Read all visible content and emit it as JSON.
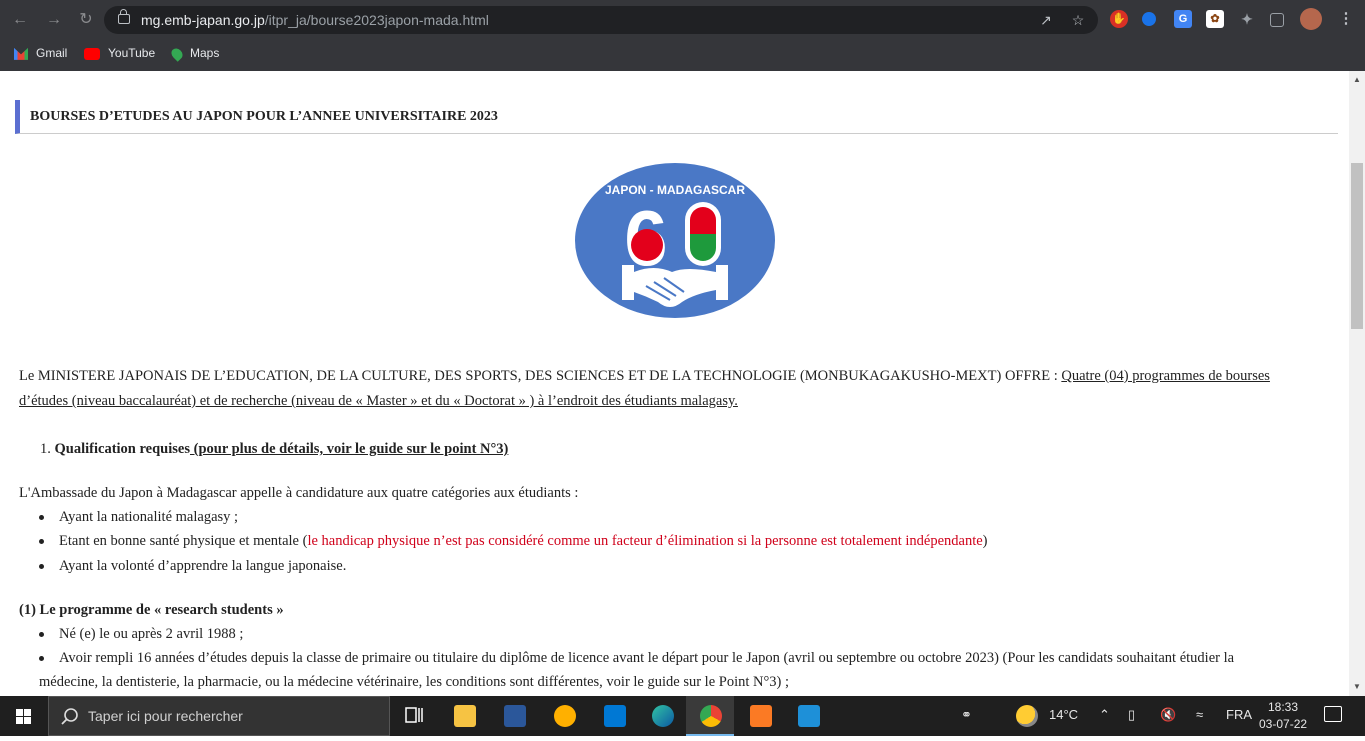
{
  "browser": {
    "url_host": "mg.emb-japan.go.jp",
    "url_path": "/itpr_ja/bourse2023japon-mada.html",
    "bookmarks": [
      "Gmail",
      "YouTube",
      "Maps"
    ]
  },
  "page": {
    "heading": "BOURSES D’ETUDES AU JAPON POUR L’ANNEE UNIVERSITAIRE 2023",
    "logo": {
      "text": "JAPON - MADAGASCAR",
      "number": "60"
    },
    "intro_a": "Le MINISTERE JAPONAIS DE L’EDUCATION, DE LA CULTURE, DES SPORTS, DES SCIENCES ET DE LA TECHNOLOGIE (MONBUKAGAKUSHO-MEXT) OFFRE : ",
    "intro_b": "Quatre (04) programmes de bourses",
    "intro_c": "d’études (niveau baccalauréat) et de recherche (niveau de « Master » et du « Doctorat » ) à l’endroit des étudiants malagasy.",
    "section1_num": "1.",
    "section1_bold": "Qualification requises",
    "section1_link": " (pour plus de détails, voir le guide sur le point N°3)",
    "ambassade": "L'Ambassade du Japon à Madagascar appelle à candidature aux quatre catégories aux étudiants :",
    "bullet1": "Ayant la nationalité malagasy ;",
    "bullet2_a": "Etant en bonne santé physique et mentale (",
    "bullet2_red": "le handicap physique n’est pas considéré comme un facteur d’élimination si la personne est totalement indépendante",
    "bullet2_c": ")",
    "bullet3": "Ayant la volonté d’apprendre la langue japonaise.",
    "programme1": "(1) Le programme de « research students »",
    "p1_bullet1": "Né (e) le ou après 2 avril 1988 ;",
    "p1_bullet2_line1": "Avoir rempli 16 années d’études depuis la classe de primaire ou titulaire du diplôme de licence avant le départ pour le Japon (avril ou septembre ou octobre 2023) (Pour les candidats souhaitant étudier la",
    "p1_bullet2_line2": "médecine, la dentisterie, la pharmacie, ou la médecine vétérinaire, les conditions sont différentes, voir le guide sur le Point N°3) ;"
  },
  "taskbar": {
    "search_placeholder": "Taper ici pour rechercher",
    "weather": "14°C",
    "language": "FRA",
    "time": "18:33",
    "date": "03-07-22"
  }
}
